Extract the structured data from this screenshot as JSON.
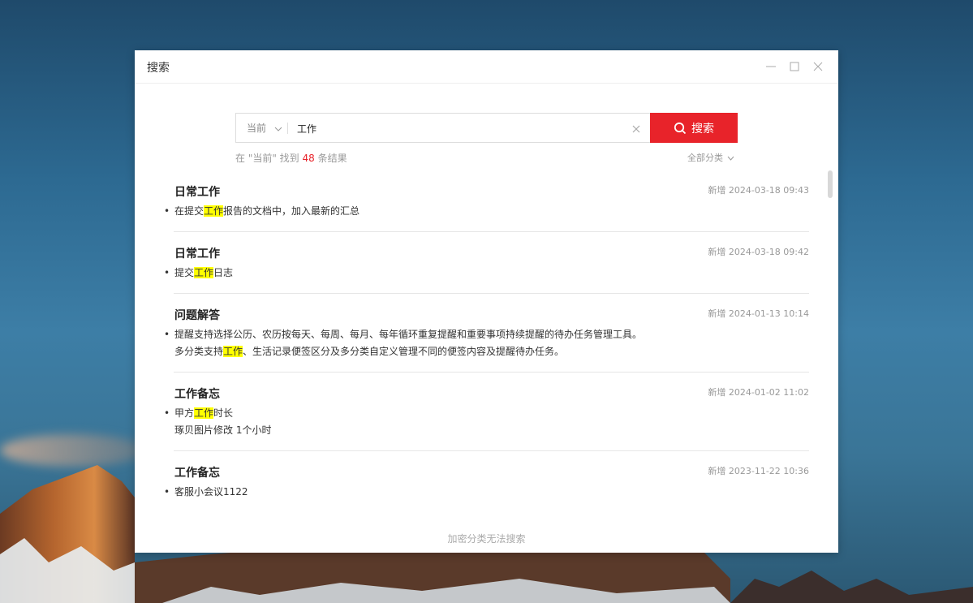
{
  "window": {
    "title": "搜索"
  },
  "search": {
    "scope": "当前",
    "query": "工作",
    "button_label": "搜索"
  },
  "summary": {
    "prefix": "在 \"当前\" 找到 ",
    "count": "48",
    "suffix": " 条结果",
    "category_filter": "全部分类"
  },
  "results": [
    {
      "title": "日常工作",
      "time": "新增 2024-03-18 09:43",
      "lines": [
        {
          "before": "在提交",
          "hl": "工作",
          "after": "报告的文档中，加入最新的汇总"
        }
      ]
    },
    {
      "title": "日常工作",
      "time": "新增 2024-03-18 09:42",
      "lines": [
        {
          "before": "提交",
          "hl": "工作",
          "after": "日志"
        }
      ]
    },
    {
      "title": "问题解答",
      "time": "新增 2024-01-13 10:14",
      "lines": [
        {
          "before": "提醒支持选择公历、农历按每天、每周、每月、每年循环重复提醒和重要事项持续提醒的待办任务管理工具。",
          "hl": "",
          "after": ""
        },
        {
          "before": "多分类支持",
          "hl": "工作",
          "after": "、生活记录便签区分及多分类自定义管理不同的便签内容及提醒待办任务。"
        }
      ]
    },
    {
      "title": "工作备忘",
      "time": "新增 2024-01-02 11:02",
      "lines": [
        {
          "before": "甲方",
          "hl": "工作",
          "after": "时长"
        },
        {
          "before": "琢贝图片修改 1个小时",
          "hl": "",
          "after": ""
        }
      ]
    },
    {
      "title": "工作备忘",
      "time": "新增 2023-11-22 10:36",
      "lines": [
        {
          "before": "客服小会议1122",
          "hl": "",
          "after": ""
        }
      ]
    }
  ],
  "footer": {
    "note": "加密分类无法搜索"
  }
}
